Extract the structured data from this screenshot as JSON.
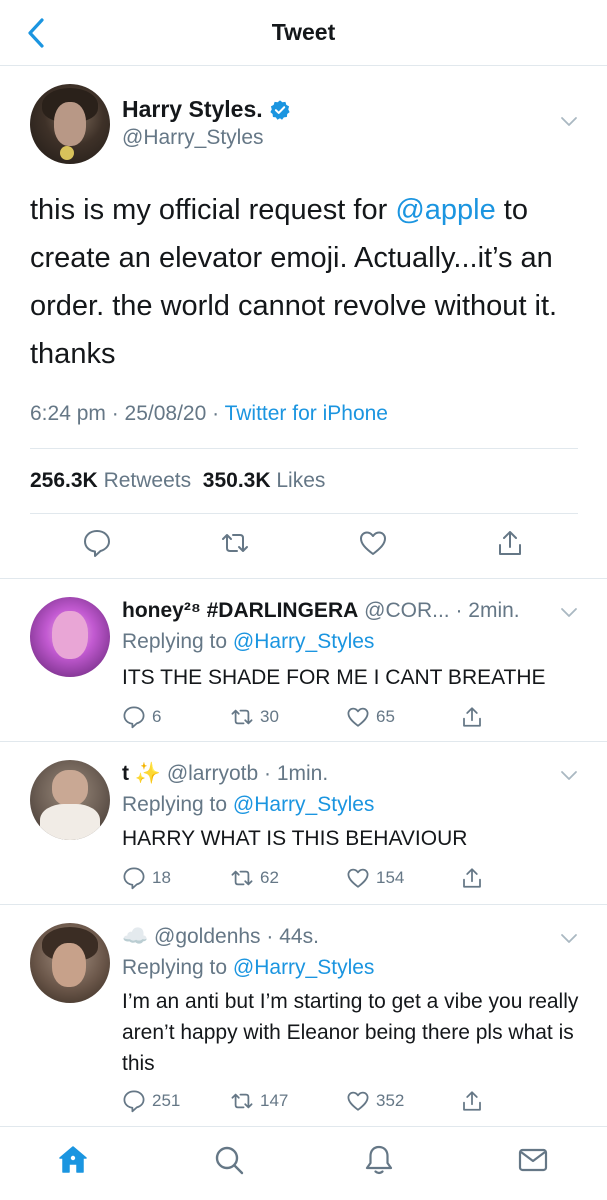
{
  "header": {
    "title": "Tweet"
  },
  "tweet": {
    "author_name": "Harry Styles.",
    "author_handle": "@Harry_Styles",
    "text_parts": [
      "this is my official request for ",
      "@apple",
      " to create an elevator emoji. Actually...it’s an order. the world cannot revolve without it. thanks"
    ],
    "time": "6:24 pm · 25/08/20 · ",
    "source": "Twitter for iPhone",
    "retweets_count": "256.3K",
    "retweets_label": "Retweets",
    "likes_count": "350.3K",
    "likes_label": "Likes"
  },
  "replies": [
    {
      "name": "honey²⁸ #DARLINGERA",
      "handle": "@COR... · 2min.",
      "replying_prefix": "Replying to ",
      "replying_to": "@Harry_Styles",
      "text": "ITS THE SHADE FOR ME I CANT BREATHE",
      "reply_count": "6",
      "retweet_count": "30",
      "like_count": "65"
    },
    {
      "name": "t ✨",
      "handle": "@larryotb · 1min.",
      "replying_prefix": "Replying to ",
      "replying_to": "@Harry_Styles",
      "text": "HARRY WHAT IS THIS BEHAVIOUR",
      "reply_count": "18",
      "retweet_count": "62",
      "like_count": "154"
    },
    {
      "name": "☁️",
      "handle": "@goldenhs · 44s.",
      "replying_prefix": "Replying to ",
      "replying_to": "@Harry_Styles",
      "text": "I’m an anti but I’m starting to get a vibe you really aren’t happy with Eleanor being there pls what is this",
      "reply_count": "251",
      "retweet_count": "147",
      "like_count": "352"
    }
  ],
  "colors": {
    "accent": "#1b95e0",
    "text": "#14171a",
    "muted": "#657786",
    "divider": "#e1e8ed"
  },
  "icons": [
    "back-chevron-icon",
    "verified-badge-icon",
    "reply-icon",
    "retweet-icon",
    "like-icon",
    "share-icon",
    "home-icon",
    "search-icon",
    "notifications-icon",
    "messages-icon"
  ]
}
